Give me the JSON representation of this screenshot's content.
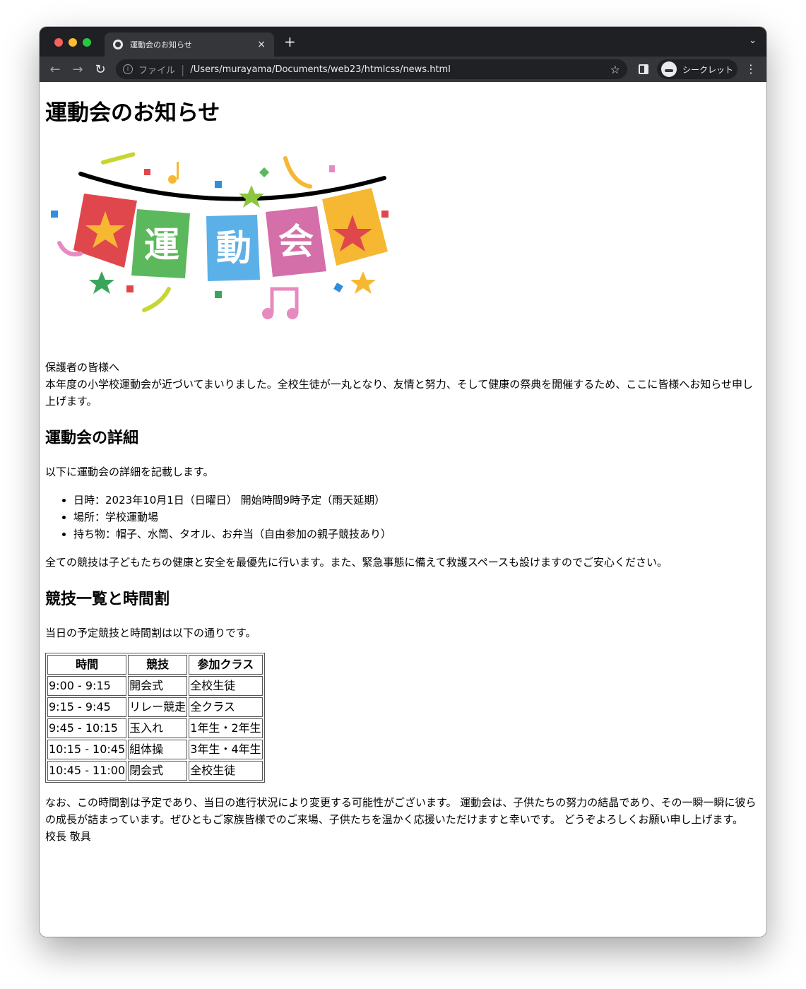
{
  "browser": {
    "tab_title": "運動会のお知らせ",
    "tab_close": "×",
    "new_tab": "+",
    "scheme_label": "ファイル",
    "url": "/Users/murayama/Documents/web23/htmlcss/news.html",
    "profile_label": "シークレット"
  },
  "page": {
    "title": "運動会のお知らせ",
    "banner_text": "運動会",
    "greeting": "保護者の皆様へ",
    "intro": "本年度の小学校運動会が近づいてまいりました。全校生徒が一丸となり、友情と努力、そして健康の祭典を開催するため、ここに皆様へお知らせ申し上げます。",
    "section_details": {
      "heading": "運動会の詳細",
      "lead": "以下に運動会の詳細を記載します。",
      "items": [
        "日時：2023年10月1日（日曜日） 開始時間9時予定（雨天延期）",
        "場所：学校運動場",
        "持ち物：帽子、水筒、タオル、お弁当（自由参加の親子競技あり）"
      ],
      "note": "全ての競技は子どもたちの健康と安全を最優先に行います。また、緊急事態に備えて救護スペースも設けますのでご安心ください。"
    },
    "section_schedule": {
      "heading": "競技一覧と時間割",
      "lead": "当日の予定競技と時間割は以下の通りです。",
      "columns": [
        "時間",
        "競技",
        "参加クラス"
      ],
      "rows": [
        [
          "9:00 - 9:15",
          "開会式",
          "全校生徒"
        ],
        [
          "9:15 - 9:45",
          "リレー競走",
          "全クラス"
        ],
        [
          "9:45 - 10:15",
          "玉入れ",
          "1年生・2年生"
        ],
        [
          "10:15 - 10:45",
          "組体操",
          "3年生・4年生"
        ],
        [
          "10:45 - 11:00",
          "閉会式",
          "全校生徒"
        ]
      ]
    },
    "closing": "なお、この時間割は予定であり、当日の進行状況により変更する可能性がございます。 運動会は、子供たちの努力の結晶であり、その一瞬一瞬に彼らの成長が詰まっています。ぜひともご家族皆様でのご来場、子供たちを温かく応援いただけますと幸いです。 どうぞよろしくお願い申し上げます。",
    "signature": "校長 敬具"
  }
}
